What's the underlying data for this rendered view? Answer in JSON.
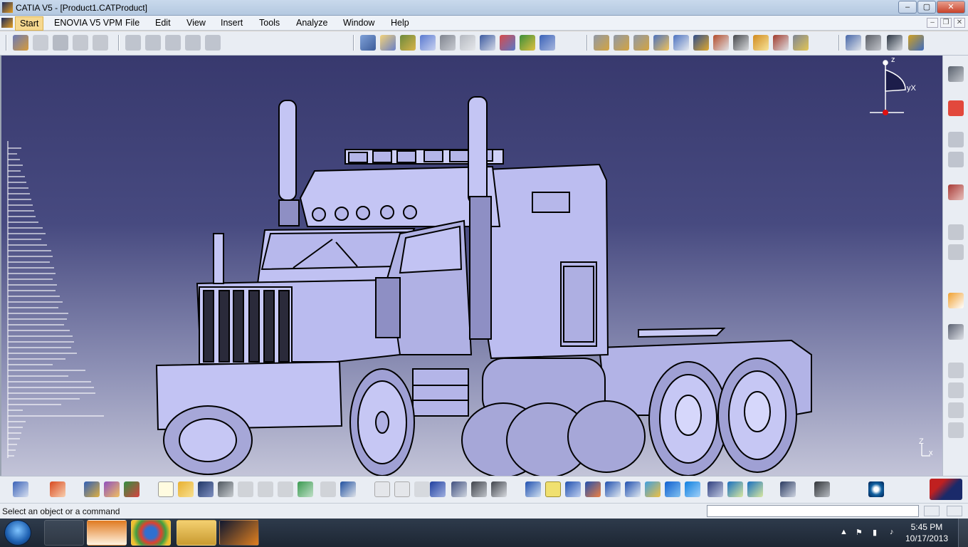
{
  "window": {
    "title": "CATIA V5 - [Product1.CATProduct]",
    "minimize": "–",
    "maximize": "▢",
    "close": "✕"
  },
  "menubar": {
    "items": [
      "Start",
      "ENOVIA V5 VPM",
      "File",
      "Edit",
      "View",
      "Insert",
      "Tools",
      "Analyze",
      "Window",
      "Help"
    ],
    "doc_minimize": "–",
    "doc_restore": "❐",
    "doc_close": "✕"
  },
  "compass": {
    "z": "z",
    "yx": "yX"
  },
  "corner_axis": {
    "z": "Z",
    "x": "x"
  },
  "status": {
    "message": "Select an object or a command"
  },
  "taskbar": {
    "time": "5:45 PM",
    "date": "10/17/2013"
  },
  "colors": {
    "viewport_top": "#38396e",
    "viewport_bottom": "#c3c4d8",
    "model_fill": "#b8b9ec",
    "model_stroke": "#000000"
  }
}
